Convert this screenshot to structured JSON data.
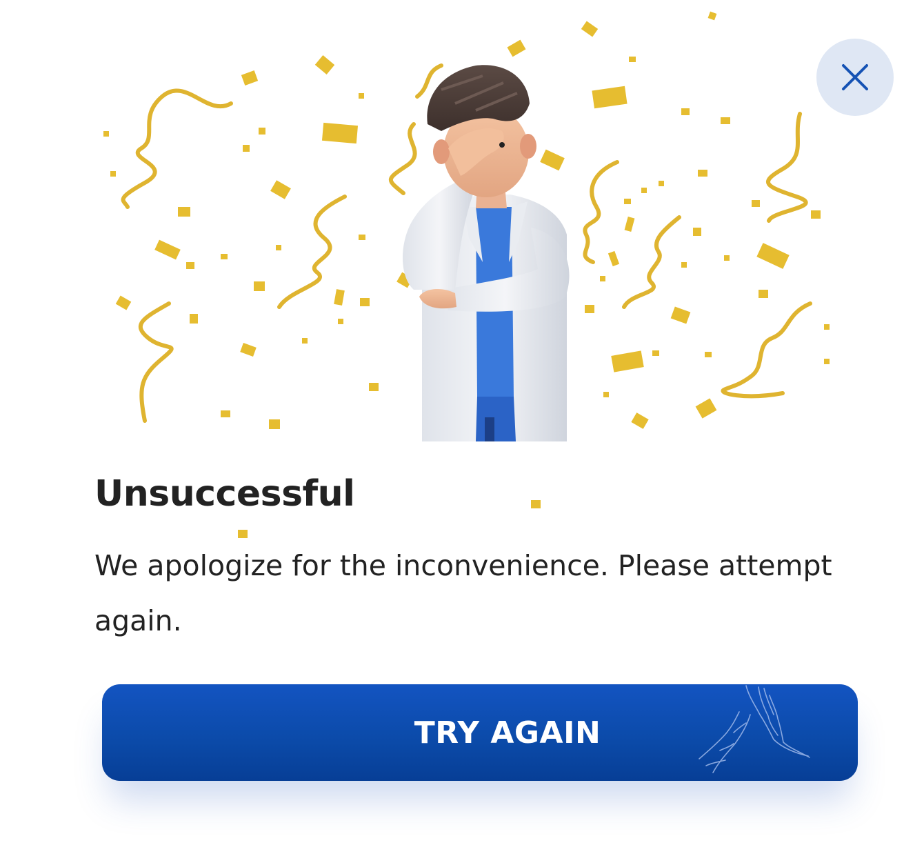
{
  "dialog": {
    "title": "Unsuccessful",
    "message": "We apologize for the inconvenience. Please attempt again.",
    "primary_button_label": "TRY AGAIN"
  },
  "icons": {
    "close": "close-icon",
    "illustration": "facepalm-doctor-illustration",
    "confetti": "confetti-decoration",
    "button_art": "hands-high-five-icon"
  },
  "colors": {
    "accent": "#0b4aa8",
    "close_bg": "#dfe7f4",
    "close_icon": "#1552b4",
    "text": "#222222",
    "confetti": "#e2b82e"
  }
}
